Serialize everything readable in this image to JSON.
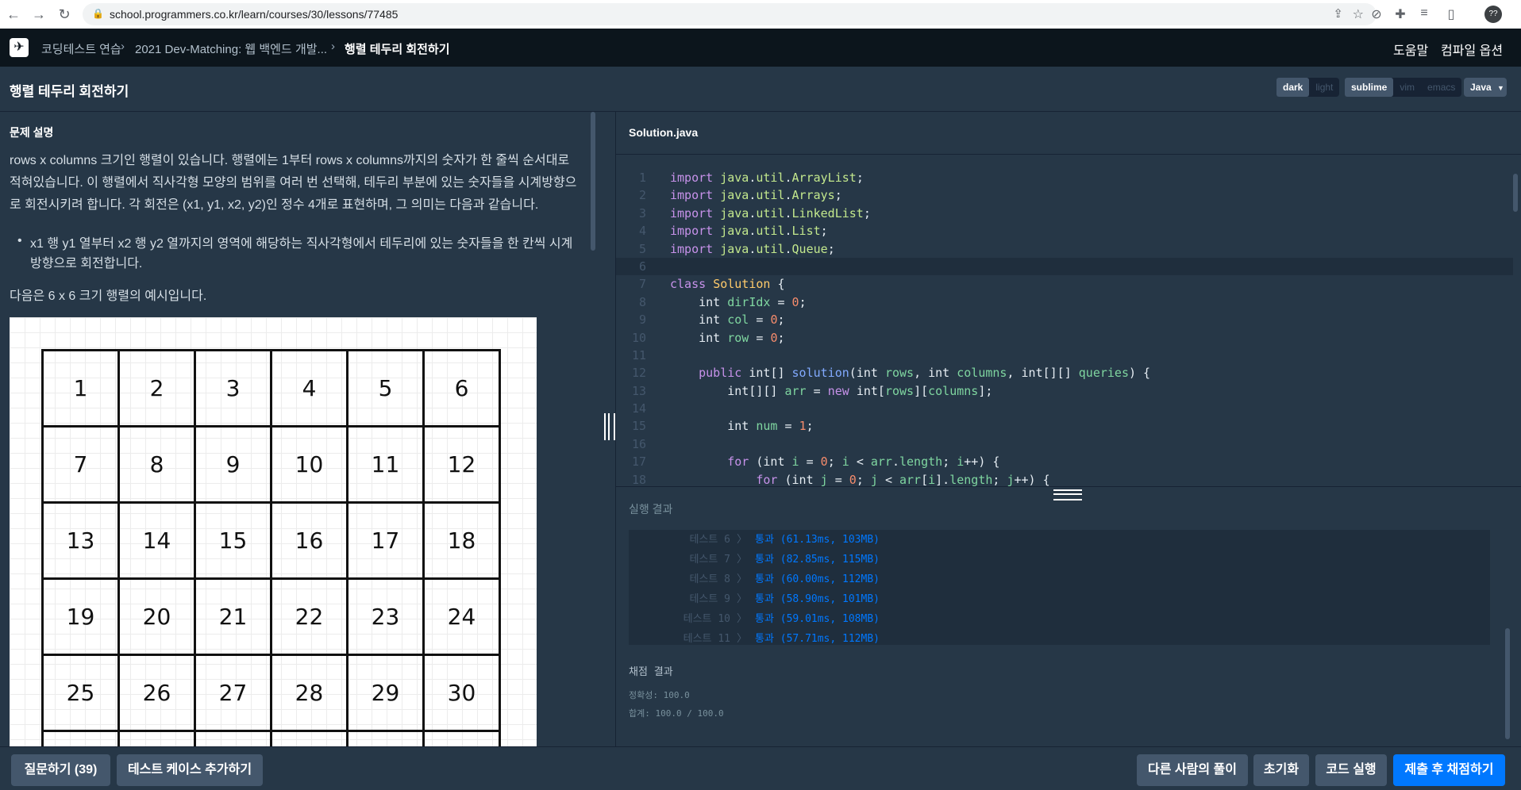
{
  "browser": {
    "url": "school.programmers.co.kr/learn/courses/30/lessons/77485",
    "profile_label": "??"
  },
  "nav": {
    "crumbs": [
      "코딩테스트 연습",
      "2021 Dev-Matching: 웹 백엔드 개발...",
      "행렬 테두리 회전하기"
    ],
    "help": "도움말",
    "compile_options": "컴파일 옵션"
  },
  "title": "행렬 테두리 회전하기",
  "theme_toggle": [
    "dark",
    "light"
  ],
  "keymap_toggle": [
    "sublime",
    "vim",
    "emacs"
  ],
  "language": "Java",
  "problem": {
    "heading": "문제 설명",
    "para1": "rows x columns 크기인 행렬이 있습니다. 행렬에는 1부터 rows x columns까지의 숫자가 한 줄씩 순서대로 적혀있습니다. 이 행렬에서 직사각형 모양의 범위를 여러 번 선택해, 테두리 부분에 있는 숫자들을 시계방향으로 회전시키려 합니다. 각 회전은 (x1, y1, x2, y2)인 정수 4개로 표현하며, 그 의미는 다음과 같습니다.",
    "bullet": "x1 행 y1 열부터 x2 행 y2 열까지의 영역에 해당하는 직사각형에서 테두리에 있는 숫자들을 한 칸씩 시계방향으로 회전합니다.",
    "example_caption": "다음은 6 x 6 크기 행렬의 예시입니다.",
    "matrix": [
      "1",
      "2",
      "3",
      "4",
      "5",
      "6",
      "7",
      "8",
      "9",
      "10",
      "11",
      "12",
      "13",
      "14",
      "15",
      "16",
      "17",
      "18",
      "19",
      "20",
      "21",
      "22",
      "23",
      "24",
      "25",
      "26",
      "27",
      "28",
      "29",
      "30",
      "",
      "",
      "",
      "",
      "",
      ""
    ]
  },
  "editor": {
    "filename": "Solution.java"
  },
  "results": {
    "heading": "실행 결과",
    "tests": [
      {
        "label": "테스트 6",
        "result": "통과 (61.13ms, 103MB)"
      },
      {
        "label": "테스트 7",
        "result": "통과 (82.85ms, 115MB)"
      },
      {
        "label": "테스트 8",
        "result": "통과 (60.00ms, 112MB)"
      },
      {
        "label": "테스트 9",
        "result": "통과 (58.90ms, 101MB)"
      },
      {
        "label": "테스트 10",
        "result": "통과 (59.01ms, 108MB)"
      },
      {
        "label": "테스트 11",
        "result": "통과 (57.71ms, 112MB)"
      }
    ],
    "grading_title": "채점 결과",
    "accuracy": "정확성: 100.0",
    "total": "합계: 100.0 / 100.0"
  },
  "buttons": {
    "question": "질문하기 (39)",
    "add_testcase": "테스트 케이스 추가하기",
    "others": "다른 사람의 풀이",
    "reset": "초기화",
    "run": "코드 실행",
    "submit": "제출 후 채점하기"
  }
}
